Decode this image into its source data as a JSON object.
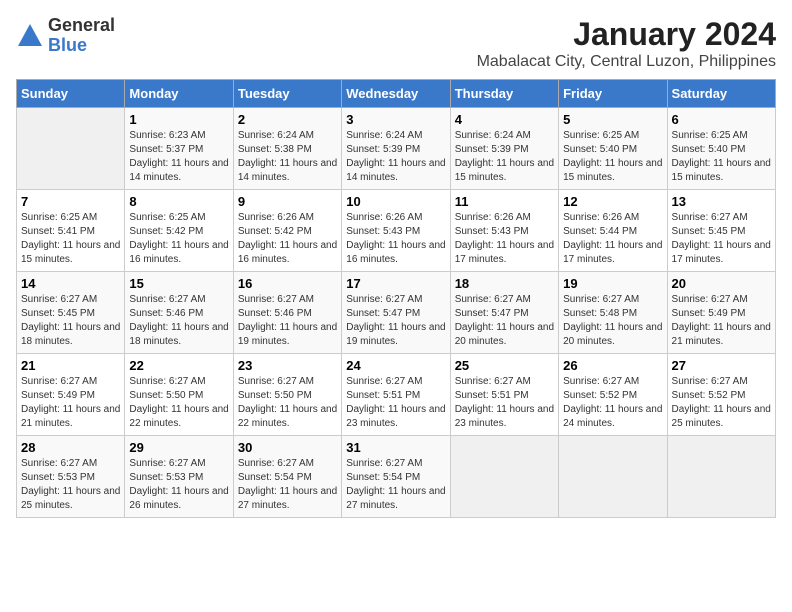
{
  "logo": {
    "general": "General",
    "blue": "Blue"
  },
  "title": "January 2024",
  "subtitle": "Mabalacat City, Central Luzon, Philippines",
  "days_of_week": [
    "Sunday",
    "Monday",
    "Tuesday",
    "Wednesday",
    "Thursday",
    "Friday",
    "Saturday"
  ],
  "weeks": [
    [
      {
        "day": "",
        "sunrise": "",
        "sunset": "",
        "daylight": ""
      },
      {
        "day": "1",
        "sunrise": "Sunrise: 6:23 AM",
        "sunset": "Sunset: 5:37 PM",
        "daylight": "Daylight: 11 hours and 14 minutes."
      },
      {
        "day": "2",
        "sunrise": "Sunrise: 6:24 AM",
        "sunset": "Sunset: 5:38 PM",
        "daylight": "Daylight: 11 hours and 14 minutes."
      },
      {
        "day": "3",
        "sunrise": "Sunrise: 6:24 AM",
        "sunset": "Sunset: 5:39 PM",
        "daylight": "Daylight: 11 hours and 14 minutes."
      },
      {
        "day": "4",
        "sunrise": "Sunrise: 6:24 AM",
        "sunset": "Sunset: 5:39 PM",
        "daylight": "Daylight: 11 hours and 15 minutes."
      },
      {
        "day": "5",
        "sunrise": "Sunrise: 6:25 AM",
        "sunset": "Sunset: 5:40 PM",
        "daylight": "Daylight: 11 hours and 15 minutes."
      },
      {
        "day": "6",
        "sunrise": "Sunrise: 6:25 AM",
        "sunset": "Sunset: 5:40 PM",
        "daylight": "Daylight: 11 hours and 15 minutes."
      }
    ],
    [
      {
        "day": "7",
        "sunrise": "Sunrise: 6:25 AM",
        "sunset": "Sunset: 5:41 PM",
        "daylight": "Daylight: 11 hours and 15 minutes."
      },
      {
        "day": "8",
        "sunrise": "Sunrise: 6:25 AM",
        "sunset": "Sunset: 5:42 PM",
        "daylight": "Daylight: 11 hours and 16 minutes."
      },
      {
        "day": "9",
        "sunrise": "Sunrise: 6:26 AM",
        "sunset": "Sunset: 5:42 PM",
        "daylight": "Daylight: 11 hours and 16 minutes."
      },
      {
        "day": "10",
        "sunrise": "Sunrise: 6:26 AM",
        "sunset": "Sunset: 5:43 PM",
        "daylight": "Daylight: 11 hours and 16 minutes."
      },
      {
        "day": "11",
        "sunrise": "Sunrise: 6:26 AM",
        "sunset": "Sunset: 5:43 PM",
        "daylight": "Daylight: 11 hours and 17 minutes."
      },
      {
        "day": "12",
        "sunrise": "Sunrise: 6:26 AM",
        "sunset": "Sunset: 5:44 PM",
        "daylight": "Daylight: 11 hours and 17 minutes."
      },
      {
        "day": "13",
        "sunrise": "Sunrise: 6:27 AM",
        "sunset": "Sunset: 5:45 PM",
        "daylight": "Daylight: 11 hours and 17 minutes."
      }
    ],
    [
      {
        "day": "14",
        "sunrise": "Sunrise: 6:27 AM",
        "sunset": "Sunset: 5:45 PM",
        "daylight": "Daylight: 11 hours and 18 minutes."
      },
      {
        "day": "15",
        "sunrise": "Sunrise: 6:27 AM",
        "sunset": "Sunset: 5:46 PM",
        "daylight": "Daylight: 11 hours and 18 minutes."
      },
      {
        "day": "16",
        "sunrise": "Sunrise: 6:27 AM",
        "sunset": "Sunset: 5:46 PM",
        "daylight": "Daylight: 11 hours and 19 minutes."
      },
      {
        "day": "17",
        "sunrise": "Sunrise: 6:27 AM",
        "sunset": "Sunset: 5:47 PM",
        "daylight": "Daylight: 11 hours and 19 minutes."
      },
      {
        "day": "18",
        "sunrise": "Sunrise: 6:27 AM",
        "sunset": "Sunset: 5:47 PM",
        "daylight": "Daylight: 11 hours and 20 minutes."
      },
      {
        "day": "19",
        "sunrise": "Sunrise: 6:27 AM",
        "sunset": "Sunset: 5:48 PM",
        "daylight": "Daylight: 11 hours and 20 minutes."
      },
      {
        "day": "20",
        "sunrise": "Sunrise: 6:27 AM",
        "sunset": "Sunset: 5:49 PM",
        "daylight": "Daylight: 11 hours and 21 minutes."
      }
    ],
    [
      {
        "day": "21",
        "sunrise": "Sunrise: 6:27 AM",
        "sunset": "Sunset: 5:49 PM",
        "daylight": "Daylight: 11 hours and 21 minutes."
      },
      {
        "day": "22",
        "sunrise": "Sunrise: 6:27 AM",
        "sunset": "Sunset: 5:50 PM",
        "daylight": "Daylight: 11 hours and 22 minutes."
      },
      {
        "day": "23",
        "sunrise": "Sunrise: 6:27 AM",
        "sunset": "Sunset: 5:50 PM",
        "daylight": "Daylight: 11 hours and 22 minutes."
      },
      {
        "day": "24",
        "sunrise": "Sunrise: 6:27 AM",
        "sunset": "Sunset: 5:51 PM",
        "daylight": "Daylight: 11 hours and 23 minutes."
      },
      {
        "day": "25",
        "sunrise": "Sunrise: 6:27 AM",
        "sunset": "Sunset: 5:51 PM",
        "daylight": "Daylight: 11 hours and 23 minutes."
      },
      {
        "day": "26",
        "sunrise": "Sunrise: 6:27 AM",
        "sunset": "Sunset: 5:52 PM",
        "daylight": "Daylight: 11 hours and 24 minutes."
      },
      {
        "day": "27",
        "sunrise": "Sunrise: 6:27 AM",
        "sunset": "Sunset: 5:52 PM",
        "daylight": "Daylight: 11 hours and 25 minutes."
      }
    ],
    [
      {
        "day": "28",
        "sunrise": "Sunrise: 6:27 AM",
        "sunset": "Sunset: 5:53 PM",
        "daylight": "Daylight: 11 hours and 25 minutes."
      },
      {
        "day": "29",
        "sunrise": "Sunrise: 6:27 AM",
        "sunset": "Sunset: 5:53 PM",
        "daylight": "Daylight: 11 hours and 26 minutes."
      },
      {
        "day": "30",
        "sunrise": "Sunrise: 6:27 AM",
        "sunset": "Sunset: 5:54 PM",
        "daylight": "Daylight: 11 hours and 27 minutes."
      },
      {
        "day": "31",
        "sunrise": "Sunrise: 6:27 AM",
        "sunset": "Sunset: 5:54 PM",
        "daylight": "Daylight: 11 hours and 27 minutes."
      },
      {
        "day": "",
        "sunrise": "",
        "sunset": "",
        "daylight": ""
      },
      {
        "day": "",
        "sunrise": "",
        "sunset": "",
        "daylight": ""
      },
      {
        "day": "",
        "sunrise": "",
        "sunset": "",
        "daylight": ""
      }
    ]
  ]
}
